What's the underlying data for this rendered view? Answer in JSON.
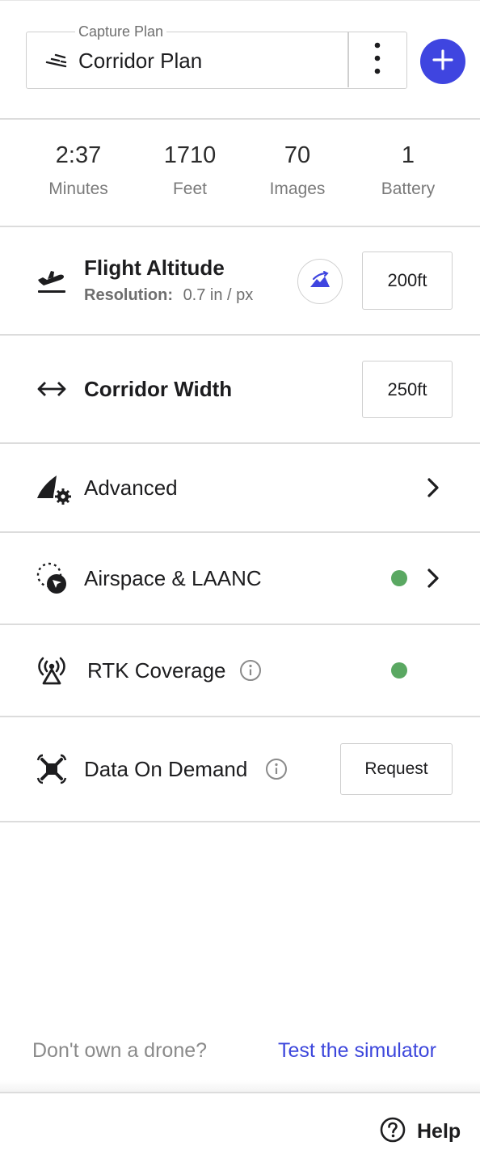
{
  "header": {
    "legend": "Capture Plan",
    "plan_name": "Corridor Plan",
    "plan_icon": "corridor-plan-icon",
    "menu_icon": "more-vertical-icon",
    "add_icon": "plus-icon",
    "accent_color": "#3f45e0"
  },
  "stats": [
    {
      "value": "2:37",
      "label": "Minutes"
    },
    {
      "value": "1710",
      "label": "Feet"
    },
    {
      "value": "70",
      "label": "Images"
    },
    {
      "value": "1",
      "label": "Battery"
    }
  ],
  "flight_altitude": {
    "title": "Flight Altitude",
    "resolution_label": "Resolution:",
    "resolution_value": "0.7 in / px",
    "value": "200ft",
    "terrain_icon": "terrain-follow-icon"
  },
  "corridor_width": {
    "title": "Corridor Width",
    "value": "250ft"
  },
  "advanced": {
    "title": "Advanced"
  },
  "airspace": {
    "title": "Airspace & LAANC",
    "status_color": "#5aa862"
  },
  "rtk": {
    "title": "RTK Coverage",
    "status_color": "#5aa862"
  },
  "data_on_demand": {
    "title": "Data On Demand",
    "button": "Request"
  },
  "footer": {
    "question": "Don't own a drone?",
    "link": "Test the simulator",
    "link_color": "#3d47dc",
    "help": "Help"
  }
}
